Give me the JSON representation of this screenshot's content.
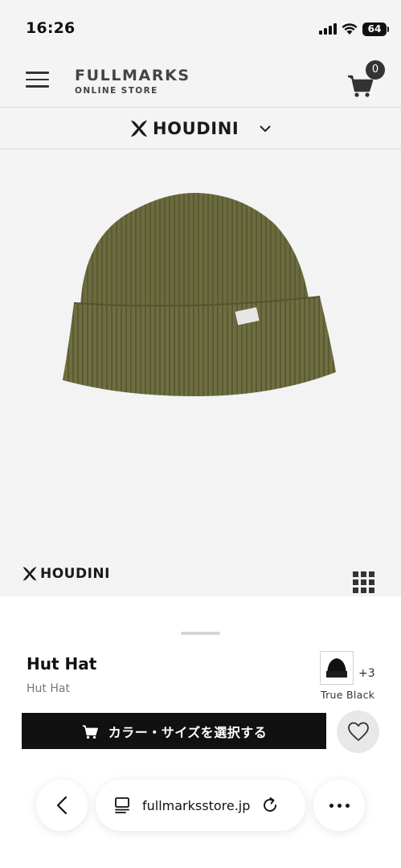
{
  "status_bar": {
    "time": "16:26",
    "battery": "64"
  },
  "header": {
    "logo_main": "FULLMARKS",
    "logo_sub": "ONLINE STORE",
    "cart_count": "0"
  },
  "brand_selector": {
    "brand": "HOUDINI"
  },
  "image_area": {
    "brand": "HOUDINI",
    "hat_color": "#6b6b3f"
  },
  "product": {
    "name": "Hut Hat",
    "subname": "Hut Hat",
    "color_label": "True Black",
    "more_colors": "+3",
    "cta_label": "カラー・サイズを選択する"
  },
  "browser": {
    "url": "fullmarksstore.jp"
  },
  "colors": {
    "cta_bg": "#111111",
    "hat": "#6b6b3f"
  }
}
